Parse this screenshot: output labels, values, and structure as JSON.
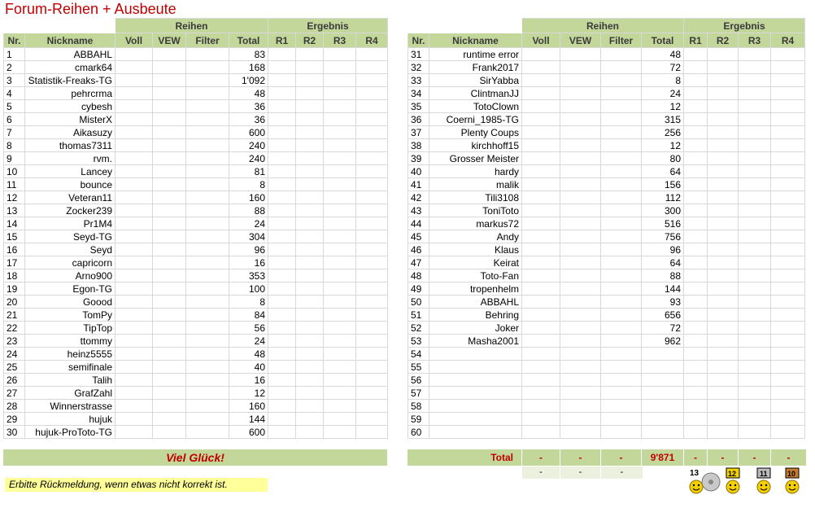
{
  "title": "Forum-Reihen + Ausbeute",
  "headers": {
    "group_reihen": "Reihen",
    "group_ergebnis": "Ergebnis",
    "nr": "Nr.",
    "nickname": "Nickname",
    "voll": "Voll",
    "vew": "VEW",
    "filter": "Filter",
    "total": "Total",
    "r1": "R1",
    "r2": "R2",
    "r3": "R3",
    "r4": "R4"
  },
  "left_rows": [
    {
      "nr": "1",
      "nick": "ABBAHL",
      "total": "83"
    },
    {
      "nr": "2",
      "nick": "cmark64",
      "total": "168"
    },
    {
      "nr": "3",
      "nick": "Statistik-Freaks-TG",
      "total": "1'092"
    },
    {
      "nr": "4",
      "nick": "pehrcrma",
      "total": "48"
    },
    {
      "nr": "5",
      "nick": "cybesh",
      "total": "36"
    },
    {
      "nr": "6",
      "nick": "MisterX",
      "total": "36"
    },
    {
      "nr": "7",
      "nick": "Aikasuzy",
      "total": "600"
    },
    {
      "nr": "8",
      "nick": "thomas7311",
      "total": "240"
    },
    {
      "nr": "9",
      "nick": "rvm.",
      "total": "240"
    },
    {
      "nr": "10",
      "nick": "Lancey",
      "total": "81"
    },
    {
      "nr": "11",
      "nick": "bounce",
      "total": "8"
    },
    {
      "nr": "12",
      "nick": "Veteran11",
      "total": "160"
    },
    {
      "nr": "13",
      "nick": "Zocker239",
      "total": "88"
    },
    {
      "nr": "14",
      "nick": "Pr1M4",
      "total": "24"
    },
    {
      "nr": "15",
      "nick": "Seyd-TG",
      "total": "304"
    },
    {
      "nr": "16",
      "nick": "Seyd",
      "total": "96"
    },
    {
      "nr": "17",
      "nick": "capricorn",
      "total": "16"
    },
    {
      "nr": "18",
      "nick": "Arno900",
      "total": "353"
    },
    {
      "nr": "19",
      "nick": "Egon-TG",
      "total": "100"
    },
    {
      "nr": "20",
      "nick": "Goood",
      "total": "8"
    },
    {
      "nr": "21",
      "nick": "TomPy",
      "total": "84"
    },
    {
      "nr": "22",
      "nick": "TipTop",
      "total": "56"
    },
    {
      "nr": "23",
      "nick": "ttommy",
      "total": "24"
    },
    {
      "nr": "24",
      "nick": "heinz5555",
      "total": "48"
    },
    {
      "nr": "25",
      "nick": "semifinale",
      "total": "40"
    },
    {
      "nr": "26",
      "nick": "Talih",
      "total": "16"
    },
    {
      "nr": "27",
      "nick": "GrafZahl",
      "total": "12"
    },
    {
      "nr": "28",
      "nick": "Winnerstrasse",
      "total": "160"
    },
    {
      "nr": "29",
      "nick": "hujuk",
      "total": "144"
    },
    {
      "nr": "30",
      "nick": "hujuk-ProToto-TG",
      "total": "600"
    }
  ],
  "right_rows": [
    {
      "nr": "31",
      "nick": "runtime error",
      "total": "48"
    },
    {
      "nr": "32",
      "nick": "Frank2017",
      "total": "72"
    },
    {
      "nr": "33",
      "nick": "SirYabba",
      "total": "8"
    },
    {
      "nr": "34",
      "nick": "ClintmanJJ",
      "total": "24"
    },
    {
      "nr": "35",
      "nick": "TotoClown",
      "total": "12"
    },
    {
      "nr": "36",
      "nick": "Coerni_1985-TG",
      "total": "315"
    },
    {
      "nr": "37",
      "nick": "Plenty Coups",
      "total": "256"
    },
    {
      "nr": "38",
      "nick": "kirchhoff15",
      "total": "12"
    },
    {
      "nr": "39",
      "nick": "Grosser Meister",
      "total": "80"
    },
    {
      "nr": "40",
      "nick": "hardy",
      "total": "64"
    },
    {
      "nr": "41",
      "nick": "malik",
      "total": "156"
    },
    {
      "nr": "42",
      "nick": "Tili3108",
      "total": "112"
    },
    {
      "nr": "43",
      "nick": "ToniToto",
      "total": "300"
    },
    {
      "nr": "44",
      "nick": "markus72",
      "total": "516"
    },
    {
      "nr": "45",
      "nick": "Andy",
      "total": "756"
    },
    {
      "nr": "46",
      "nick": "Klaus",
      "total": "96"
    },
    {
      "nr": "47",
      "nick": "Keirat",
      "total": "64"
    },
    {
      "nr": "48",
      "nick": "Toto-Fan",
      "total": "88"
    },
    {
      "nr": "49",
      "nick": "tropenhelm",
      "total": "144"
    },
    {
      "nr": "50",
      "nick": "ABBAHL",
      "total": "93"
    },
    {
      "nr": "51",
      "nick": "Behring",
      "total": "656"
    },
    {
      "nr": "52",
      "nick": "Joker",
      "total": "72"
    },
    {
      "nr": "53",
      "nick": "Masha2001",
      "total": "962"
    },
    {
      "nr": "54",
      "nick": "",
      "total": ""
    },
    {
      "nr": "55",
      "nick": "",
      "total": ""
    },
    {
      "nr": "56",
      "nick": "",
      "total": ""
    },
    {
      "nr": "57",
      "nick": "",
      "total": ""
    },
    {
      "nr": "58",
      "nick": "",
      "total": ""
    },
    {
      "nr": "59",
      "nick": "",
      "total": ""
    },
    {
      "nr": "60",
      "nick": "",
      "total": ""
    }
  ],
  "footer": {
    "luck": "Viel Glück!",
    "total_label": "Total",
    "voll": "-",
    "vew": "-",
    "filter": "-",
    "total": "9'871",
    "r1": "-",
    "r2": "-",
    "r3": "-",
    "r4": "-",
    "sub_voll": "-",
    "sub_vew": "-",
    "sub_filter": "-",
    "note": "Erbitte Rückmeldung, wenn etwas nicht korrekt ist.",
    "badges": [
      {
        "icon": "smiley-13-badge-icon",
        "text": "13"
      },
      {
        "icon": "smiley-12-badge-icon",
        "text": "12"
      },
      {
        "icon": "smiley-11-badge-icon",
        "text": "11"
      },
      {
        "icon": "smiley-10-badge-icon",
        "text": "10"
      }
    ]
  }
}
